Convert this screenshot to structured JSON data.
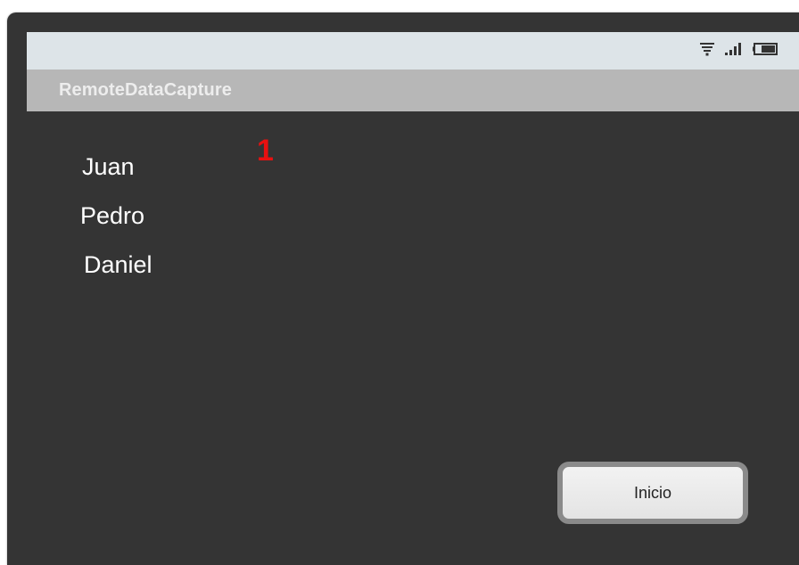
{
  "status_bar": {
    "icons": [
      "wifi-icon",
      "signal-icon",
      "battery-icon"
    ],
    "background": "#dde4e8"
  },
  "app": {
    "title": "RemoteDataCapture",
    "title_bar_color": "#b7b7b7",
    "screen_background": "#343434"
  },
  "counter": {
    "value": "1",
    "color": "#e81010"
  },
  "names": [
    "Juan",
    "Pedro",
    "Daniel"
  ],
  "buttons": {
    "inicio_label": "Inicio"
  }
}
